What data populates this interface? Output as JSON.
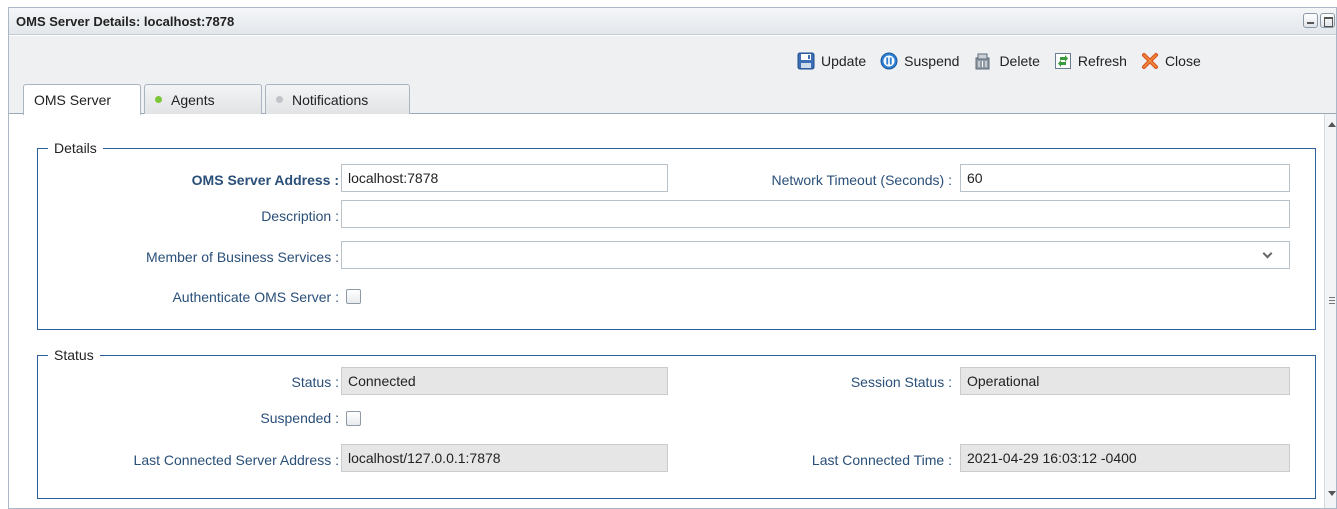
{
  "window": {
    "title": "OMS Server Details: localhost:7878"
  },
  "toolbar": {
    "buttons": [
      {
        "label": "Update",
        "icon": "save-icon"
      },
      {
        "label": "Suspend",
        "icon": "suspend-icon"
      },
      {
        "label": "Delete",
        "icon": "delete-icon"
      },
      {
        "label": "Refresh",
        "icon": "refresh-icon"
      },
      {
        "label": "Close",
        "icon": "close-icon"
      }
    ]
  },
  "tabs": [
    {
      "label": "OMS Server",
      "active": true
    },
    {
      "label": "Agents",
      "status_color": "#7cc63a"
    },
    {
      "label": "Notifications",
      "status_color": "#c0c4c8"
    }
  ],
  "details": {
    "legend": "Details",
    "oms_server_address_label": "OMS Server Address :",
    "oms_server_address_value": "localhost:7878",
    "network_timeout_label": "Network Timeout (Seconds) :",
    "network_timeout_value": "60",
    "description_label": "Description :",
    "description_value": "",
    "member_business_services_label": "Member of Business Services :",
    "member_business_services_value": "",
    "authenticate_label": "Authenticate OMS Server :",
    "authenticate_checked": false
  },
  "status": {
    "legend": "Status",
    "status_label": "Status :",
    "status_value": "Connected",
    "session_status_label": "Session Status :",
    "session_status_value": "Operational",
    "suspended_label": "Suspended :",
    "suspended_checked": false,
    "last_server_address_label": "Last Connected Server Address :",
    "last_server_address_value": "localhost/127.0.0.1:7878",
    "last_connected_time_label": "Last Connected Time :",
    "last_connected_time_value": "2021-04-29 16:03:12 -0400"
  },
  "colors": {
    "fieldset_border": "#2b5e9c",
    "label_text": "#2a4f78",
    "readonly_bg": "#e6e6e6"
  }
}
